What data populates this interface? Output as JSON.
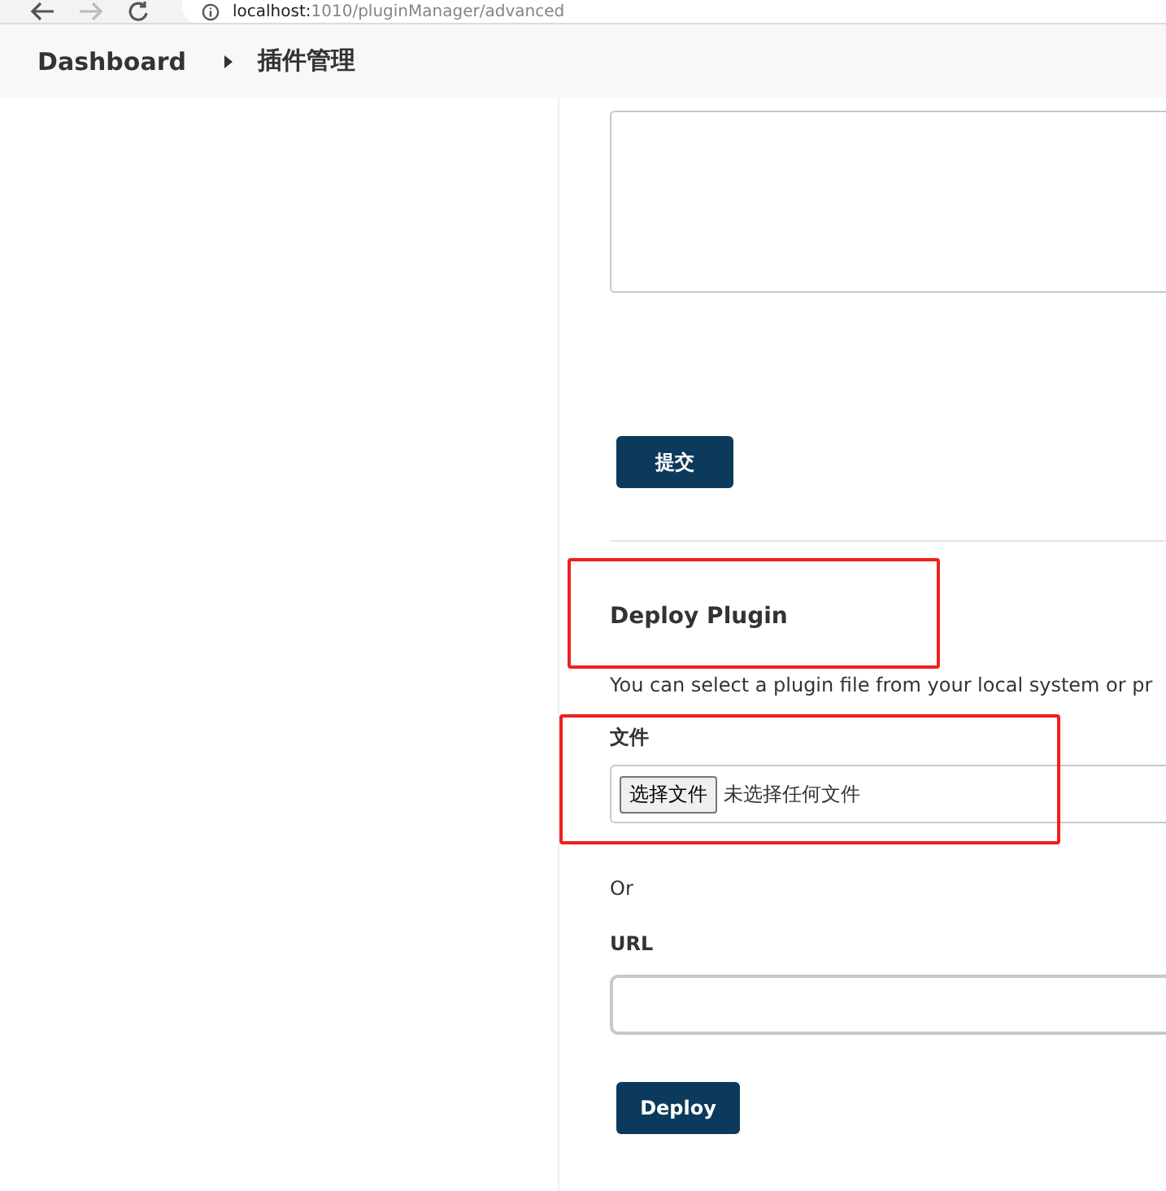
{
  "browser": {
    "url_host": "localhost:",
    "url_path": "1010/pluginManager/advanced"
  },
  "breadcrumb": [
    {
      "label": "Dashboard"
    },
    {
      "label": "插件管理"
    }
  ],
  "submit_button": "提交",
  "deploy": {
    "title": "Deploy Plugin",
    "highlighted": true,
    "description": "You can select a plugin file from your local system or pr",
    "file_label": "文件",
    "file_button": "选择文件",
    "file_status": "未选择任何文件",
    "file_highlighted": true,
    "or": "Or",
    "url_label": "URL",
    "button": "Deploy"
  }
}
